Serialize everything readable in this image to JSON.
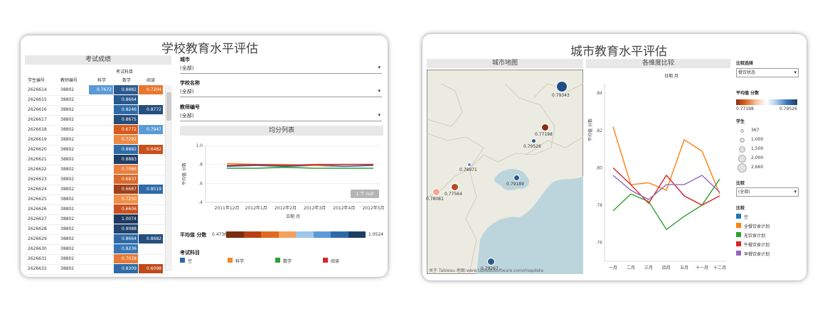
{
  "left": {
    "title": "学校教育水平评估",
    "table_header": "考试成绩",
    "subject_group": "考试科目",
    "columns": [
      "学生编号",
      "教师编号",
      "科学",
      "数学",
      "阅读"
    ],
    "rows": [
      {
        "student": "2626614",
        "teacher": "38802",
        "sci": "0.7672",
        "math": "0.8882",
        "read": "0.7204",
        "sci_color": "#5b9bd5",
        "math_color": "#2a5a8f",
        "read_color": "#e8772e"
      },
      {
        "student": "2626615",
        "teacher": "38802",
        "sci": "",
        "math": "0.8664",
        "read": "",
        "sci_color": "",
        "math_color": "#2a5a8f",
        "read_color": ""
      },
      {
        "student": "2626616",
        "teacher": "38802",
        "sci": "",
        "math": "0.8246",
        "read": "0.8772",
        "sci_color": "",
        "math_color": "#2f6ba6",
        "read_color": "#244f7e"
      },
      {
        "student": "2626617",
        "teacher": "38802",
        "sci": "",
        "math": "0.8675",
        "read": "",
        "sci_color": "",
        "math_color": "#254d7a",
        "read_color": ""
      },
      {
        "student": "2626618",
        "teacher": "38802",
        "sci": "",
        "math": "0.6772",
        "read": "0.7947",
        "sci_color": "",
        "math_color": "#d85a1c",
        "read_color": "#5b9bd5"
      },
      {
        "student": "2626619",
        "teacher": "38802",
        "sci": "",
        "math": "0.7292",
        "read": "",
        "sci_color": "",
        "math_color": "#ee8a45",
        "read_color": ""
      },
      {
        "student": "2626620",
        "teacher": "38802",
        "sci": "",
        "math": "0.8882",
        "read": "0.6482",
        "sci_color": "",
        "math_color": "#2f6ba6",
        "read_color": "#c8501c"
      },
      {
        "student": "2626621",
        "teacher": "38802",
        "sci": "",
        "math": "0.8883",
        "read": "",
        "sci_color": "",
        "math_color": "#203f66",
        "read_color": ""
      },
      {
        "student": "2626622",
        "teacher": "38802",
        "sci": "",
        "math": "0.7086",
        "read": "",
        "sci_color": "",
        "math_color": "#ea8040",
        "read_color": ""
      },
      {
        "student": "2626623",
        "teacher": "38802",
        "sci": "",
        "math": "0.6837",
        "read": "",
        "sci_color": "",
        "math_color": "#d96a2c",
        "read_color": ""
      },
      {
        "student": "2626624",
        "teacher": "38802",
        "sci": "",
        "math": "0.6687",
        "read": "0.8519",
        "sci_color": "",
        "math_color": "#a0401c",
        "read_color": "#2f6ba6"
      },
      {
        "student": "2626625",
        "teacher": "38802",
        "sci": "",
        "math": "0.7250",
        "read": "",
        "sci_color": "",
        "math_color": "#f0904a",
        "read_color": ""
      },
      {
        "student": "2626626",
        "teacher": "38802",
        "sci": "",
        "math": "0.6606",
        "read": "",
        "sci_color": "",
        "math_color": "#c85220",
        "read_color": ""
      },
      {
        "student": "2626627",
        "teacher": "38802",
        "sci": "",
        "math": "1.0074",
        "read": "",
        "sci_color": "",
        "math_color": "#1f3a5f",
        "read_color": ""
      },
      {
        "student": "2626628",
        "teacher": "38802",
        "sci": "",
        "math": "0.9088",
        "read": "",
        "sci_color": "",
        "math_color": "#22446e",
        "read_color": ""
      },
      {
        "student": "2626629",
        "teacher": "38802",
        "sci": "",
        "math": "0.8664",
        "read": "0.8682",
        "sci_color": "",
        "math_color": "#2f6ba6",
        "read_color": "#244f7e"
      },
      {
        "student": "2626630",
        "teacher": "38802",
        "sci": "",
        "math": "0.8236",
        "read": "",
        "sci_color": "",
        "math_color": "#3676b5",
        "read_color": ""
      },
      {
        "student": "2626631",
        "teacher": "38802",
        "sci": "",
        "math": "0.7028",
        "read": "",
        "sci_color": "",
        "math_color": "#e87a38",
        "read_color": ""
      },
      {
        "student": "2626632",
        "teacher": "38802",
        "sci": "",
        "math": "0.8309",
        "read": "0.6098",
        "sci_color": "",
        "math_color": "#2f6ba6",
        "read_color": "#c04a1a"
      }
    ],
    "filters": [
      {
        "label": "城市",
        "value": "(全部)"
      },
      {
        "label": "学校名称",
        "value": "(全部)"
      },
      {
        "label": "教师编号",
        "value": "(全部)"
      }
    ],
    "chart_title": "均分列表",
    "null_badge": "1 个 null",
    "avg_label": "平均值 分数",
    "avg_min": "0.4736",
    "avg_max": "1.0524",
    "avg_colors": [
      "#7b2e10",
      "#b84016",
      "#e06a22",
      "#f3a15c",
      "#9fc7e8",
      "#5b9bd5",
      "#2e6aa8",
      "#1e3e66"
    ],
    "legend_title": "考试科目",
    "legend": [
      {
        "name": "空",
        "color": "#2e6aa8"
      },
      {
        "name": "科学",
        "color": "#f08a2c"
      },
      {
        "name": "数学",
        "color": "#2ca02c"
      },
      {
        "name": "阅读",
        "color": "#d62728"
      }
    ]
  },
  "right": {
    "title": "城市教育水平评估",
    "map_header": "城市地图",
    "chart_header": "各维度比较",
    "chart_sub": "日期 月",
    "map_credit": "关于 Tableau 地图:www.tableausoftware.com/mapdata",
    "map_points": [
      {
        "label": "0.79343",
        "color": "#1f4e86"
      },
      {
        "label": "0.77198",
        "color": "#8a2e12"
      },
      {
        "label": "0.79526",
        "color": "#2a5a8f"
      },
      {
        "label": "0.78971",
        "color": "#5b8fc8"
      },
      {
        "label": "0.79189",
        "color": "#2a5a8f"
      },
      {
        "label": "0.77564",
        "color": "#b84a20"
      },
      {
        "label": "0.78081",
        "color": "#f4a58a"
      },
      {
        "label": "0.79267",
        "color": "#2a5a8f"
      }
    ],
    "compare_select_label": "比较选择",
    "compare_select_value": "餐饮状态",
    "avg_label": "平均值 分数",
    "avg_min": "0.77198",
    "avg_max": "0.79526",
    "student_label": "学生",
    "student_sizes": [
      "367",
      "1,000",
      "1,500",
      "2,000",
      "2,660"
    ],
    "compare_label": "比较",
    "compare_value": "(全部)",
    "compare_legend_title": "比较",
    "compare_legend": [
      {
        "name": "空",
        "color": "#1f77b4"
      },
      {
        "name": "全餐饮食计划",
        "color": "#ff7f0e"
      },
      {
        "name": "无饮食计划",
        "color": "#2ca02c"
      },
      {
        "name": "午餐饮食计划",
        "color": "#d62728"
      },
      {
        "name": "早餐饮食计划",
        "color": "#9467bd"
      }
    ]
  },
  "chart_data": [
    {
      "type": "line",
      "title": "均分列表",
      "xlabel": "日期 月",
      "ylabel": "平均值 分数",
      "categories": [
        "2011年12月",
        "2012年1月",
        "2012年2月",
        "2012年3月",
        "2012年4月",
        "2012年5月"
      ],
      "ylim": [
        0.4,
        1.0
      ],
      "yticks": [
        "1.0",
        ".8",
        ".6",
        ".4"
      ],
      "series": [
        {
          "name": "空",
          "color": "#2e6aa8",
          "values": [
            0.78,
            0.79,
            0.78,
            0.79,
            0.78,
            0.79
          ]
        },
        {
          "name": "科学",
          "color": "#f08a2c",
          "values": [
            0.81,
            0.8,
            0.8,
            0.79,
            0.8,
            0.8
          ]
        },
        {
          "name": "数学",
          "color": "#2ca02c",
          "values": [
            0.76,
            0.76,
            0.77,
            0.76,
            0.76,
            0.76
          ]
        },
        {
          "name": "阅读",
          "color": "#d62728",
          "values": [
            0.79,
            0.8,
            0.79,
            0.8,
            0.8,
            0.8
          ]
        }
      ]
    },
    {
      "type": "line",
      "title": "各维度比较",
      "xlabel": "日期 月",
      "ylabel": "平均值 分数",
      "categories": [
        "一月",
        "二月",
        "三月",
        "四月",
        "五月",
        "十一月",
        "十二月"
      ],
      "ylim": [
        0.75,
        0.845
      ],
      "yticks": [
        ".84",
        ".82",
        ".80",
        ".78",
        ".76"
      ],
      "series": [
        {
          "name": "全餐饮食计划",
          "color": "#ff7f0e",
          "values": [
            0.822,
            0.791,
            0.792,
            0.788,
            0.815,
            0.809,
            0.786
          ]
        },
        {
          "name": "无饮食计划",
          "color": "#2ca02c",
          "values": [
            0.777,
            0.786,
            0.782,
            0.767,
            0.774,
            0.78,
            0.794
          ]
        },
        {
          "name": "午餐饮食计划",
          "color": "#d62728",
          "values": [
            0.8,
            0.791,
            0.781,
            0.796,
            0.785,
            0.78,
            0.785
          ]
        },
        {
          "name": "早餐饮食计划",
          "color": "#9467bd",
          "values": [
            0.796,
            0.788,
            0.783,
            0.791,
            0.791,
            0.796,
            0.787
          ]
        }
      ]
    }
  ]
}
